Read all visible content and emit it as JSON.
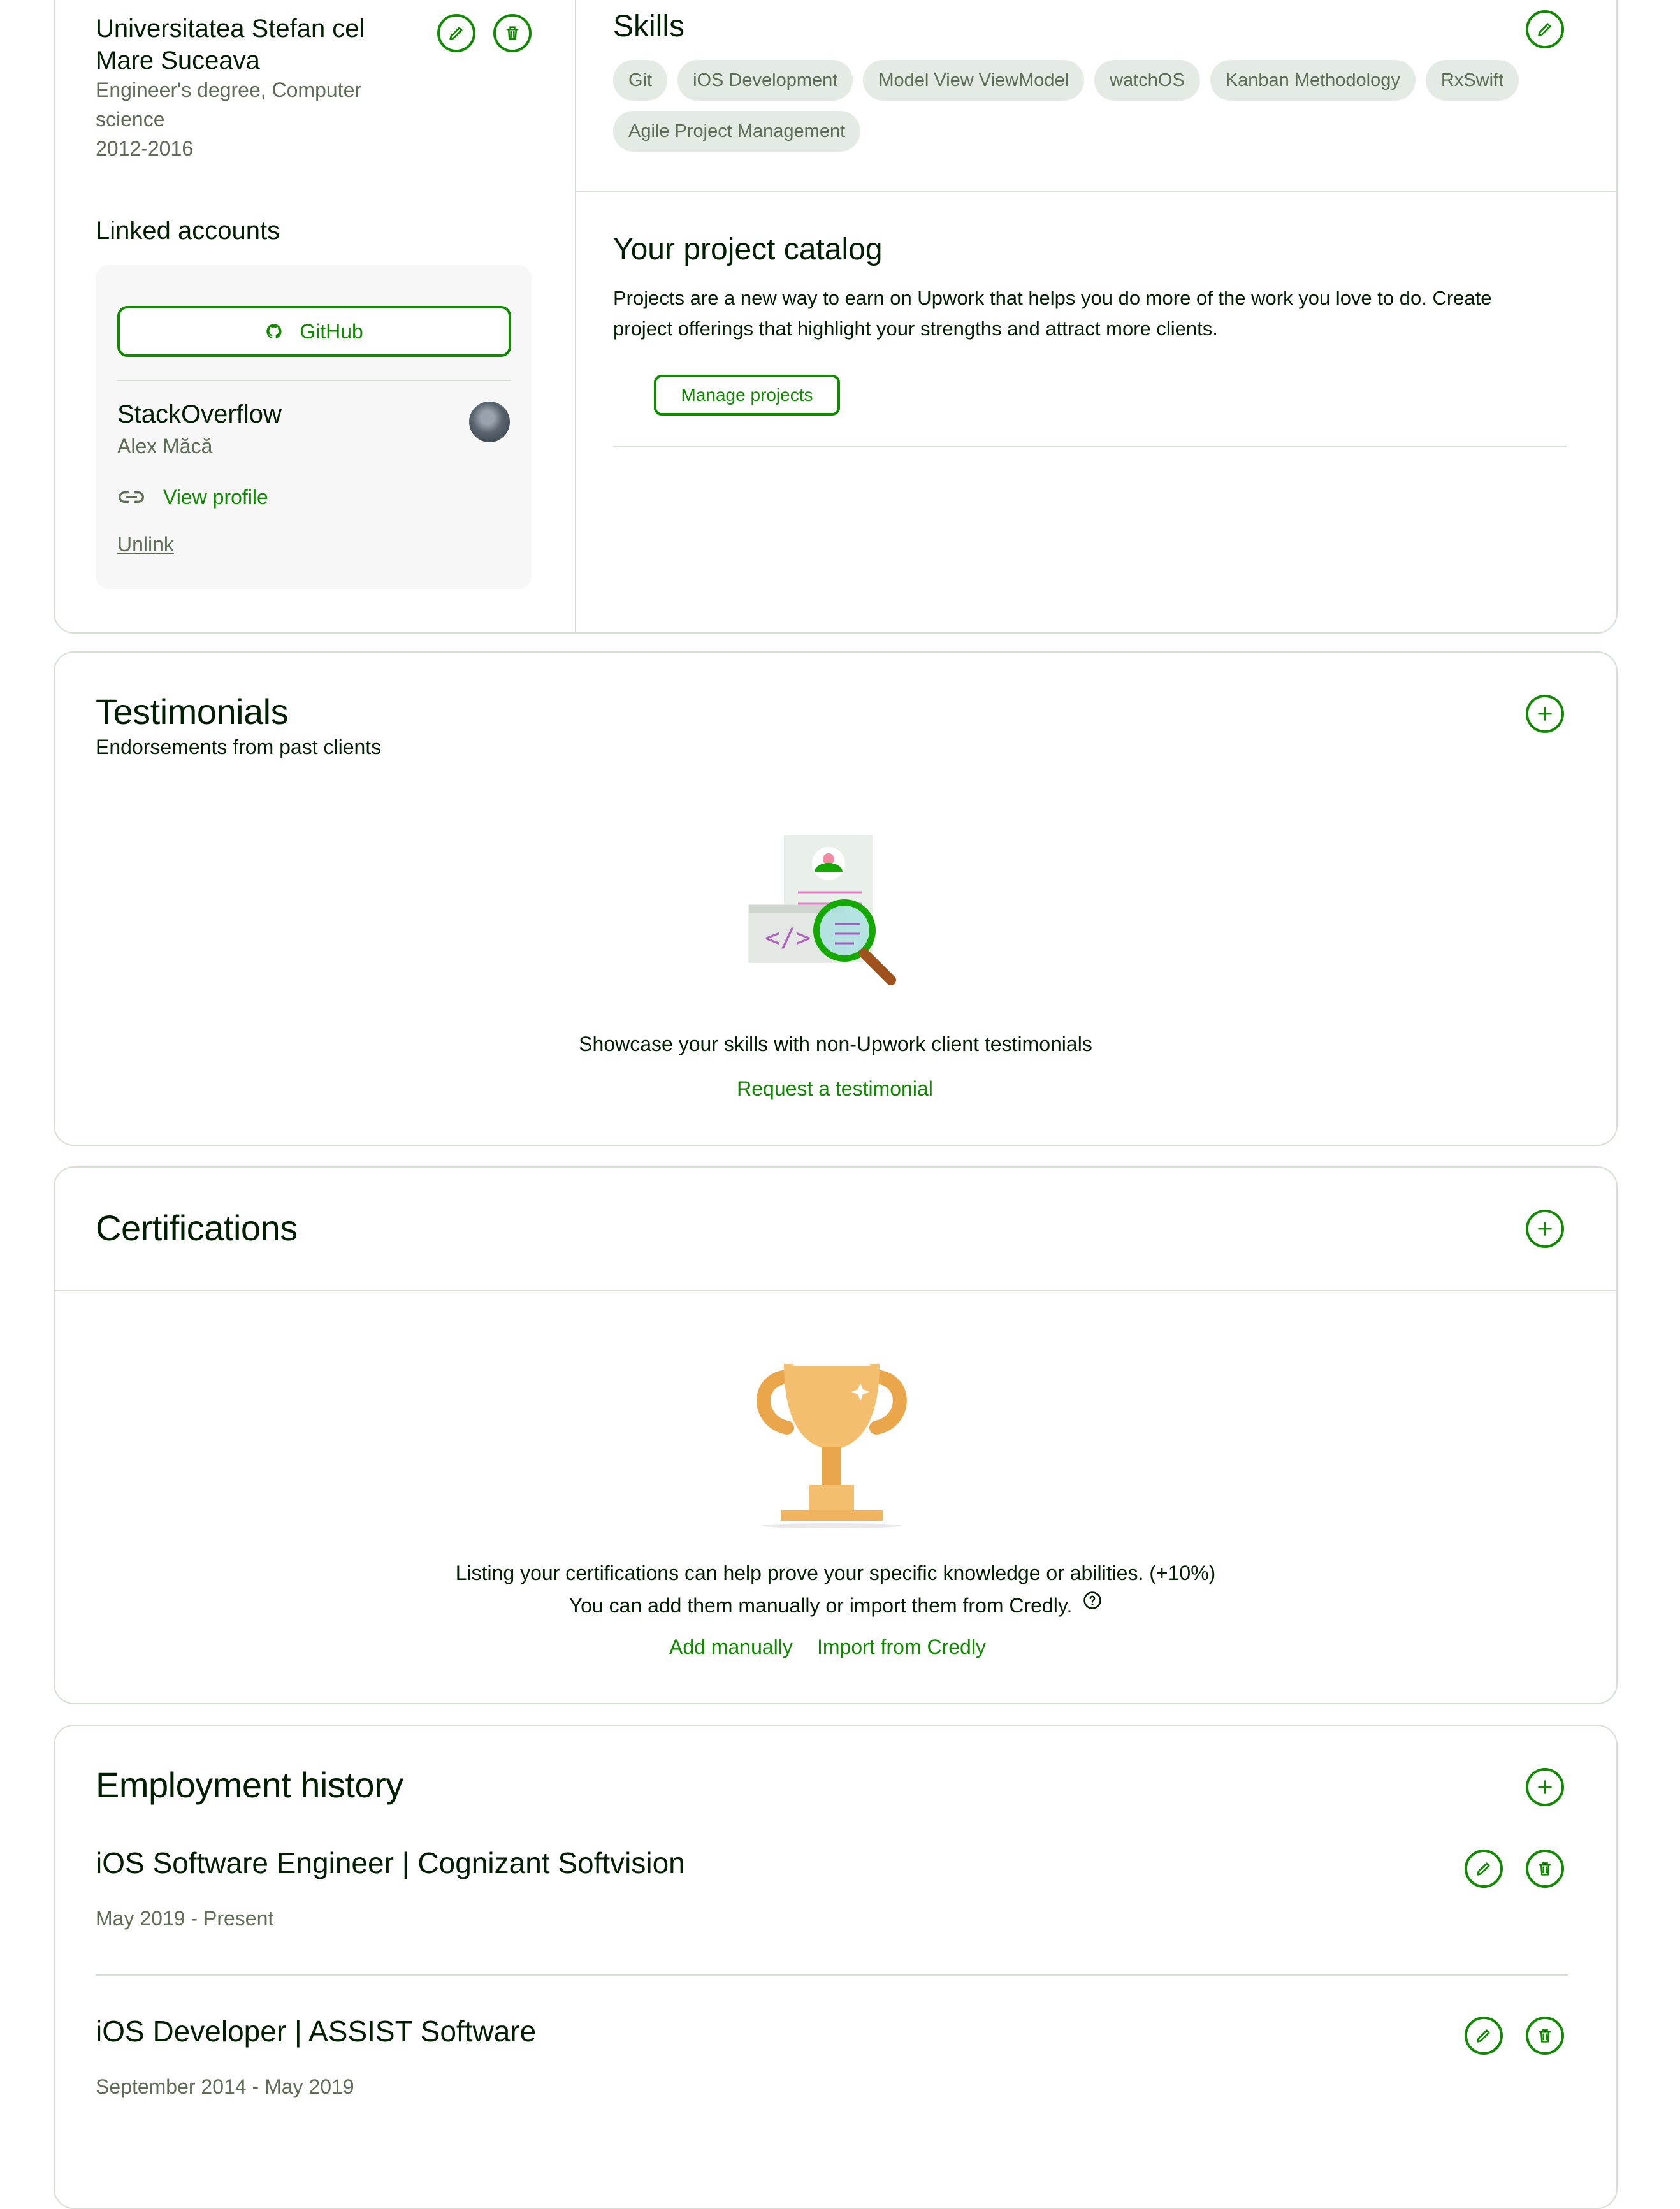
{
  "education": {
    "school": "Universitatea Stefan cel Mare Suceava",
    "degree": "Engineer's degree, Computer science",
    "years": "2012-2016"
  },
  "linked_accounts": {
    "title": "Linked accounts",
    "github_label": "GitHub",
    "stackoverflow": {
      "name": "StackOverflow",
      "user": "Alex Măcă",
      "view_profile": "View profile",
      "unlink": "Unlink"
    }
  },
  "skills": {
    "title": "Skills",
    "items": [
      "Git",
      "iOS Development",
      "Model View ViewModel",
      "watchOS",
      "Kanban Methodology",
      "RxSwift",
      "Agile Project Management"
    ]
  },
  "project_catalog": {
    "title": "Your project catalog",
    "description": "Projects are a new way to earn on Upwork that helps you do more of the work you love to do. Create project offerings that highlight your strengths and attract more clients.",
    "manage_button": "Manage projects"
  },
  "testimonials": {
    "title": "Testimonials",
    "subtitle": "Endorsements from past clients",
    "empty_text": "Showcase your skills with non-Upwork client testimonials",
    "request_link": "Request a testimonial"
  },
  "certifications": {
    "title": "Certifications",
    "line1": "Listing your certifications can help prove your specific knowledge or abilities. (+10%)",
    "line2": "You can add them manually or import them from Credly.",
    "add_manually": "Add manually",
    "import_credly": "Import from Credly"
  },
  "employment": {
    "title": "Employment history",
    "jobs": [
      {
        "title": "iOS Software Engineer | Cognizant Softvision",
        "dates": "May 2019 - Present"
      },
      {
        "title": "iOS Developer | ASSIST Software",
        "dates": "September 2014 - May 2019"
      }
    ]
  },
  "colors": {
    "accent": "#108a00",
    "border": "#d5e0d5",
    "chip_bg": "#e4ebe4",
    "muted_text": "#5e6d55"
  },
  "icons": [
    "pencil-icon",
    "trash-icon",
    "plus-icon",
    "github-icon",
    "link-icon",
    "help-icon"
  ]
}
